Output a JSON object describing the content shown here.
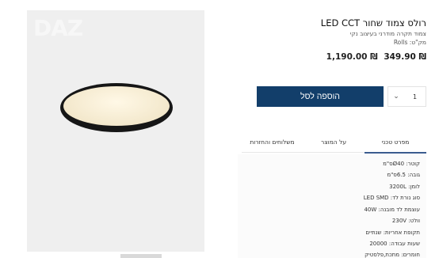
{
  "gallery": {
    "watermark": "DAZ"
  },
  "product": {
    "title": "רולס צמוד שחור LED CCT",
    "subtitle": "צמוד תקרה מודרני בעיצוב נקי",
    "sku": "מק\"ט: Rolls",
    "price_sale": "₪ 349.90",
    "price_old": "₪ 1,190.00"
  },
  "cart": {
    "add_label": "הוספה לסל",
    "qty_value": "1"
  },
  "tabs": {
    "spec": "מפרט טכני",
    "about": "על המוצר",
    "shipping": "משלוחים והחזרות"
  },
  "specs": [
    "קוטר: Ø40ס\"מ",
    "גובה: 6.5ס\"מ",
    "לומן: 3200L",
    "סוג נורת לד: LED SMD",
    "עוצמת לד מובנה: 40W",
    "וולט: 230V",
    "תקופת אחריות: שנתיים",
    "שעות עבודה: 20000",
    "חומרים: מתכת,פלסטיק"
  ],
  "colors": {
    "button_bg": "#123e6a",
    "active_tab": "#3b5c8f"
  }
}
